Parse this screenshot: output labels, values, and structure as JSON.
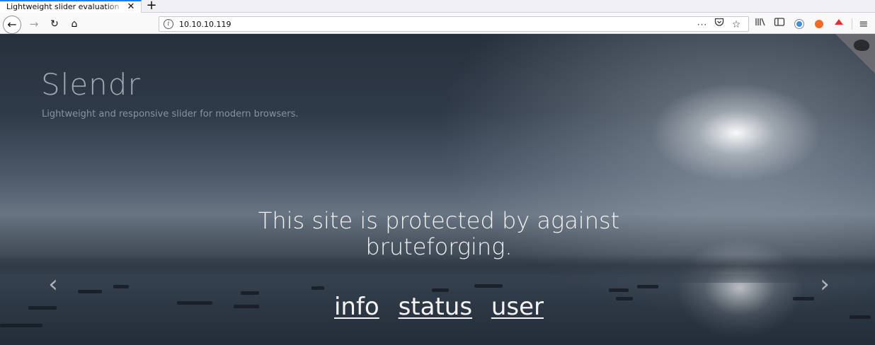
{
  "browser": {
    "tab_title": "Lightweight slider evaluation",
    "tab_close": "✕",
    "new_tab": "+",
    "url": "10.10.10.119",
    "icons": {
      "back": "back-arrow-icon",
      "forward": "forward-arrow-icon",
      "reload": "reload-icon",
      "home": "home-icon",
      "page_info": "info-icon",
      "page_actions": "more-icon",
      "pocket": "pocket-icon",
      "bookmark": "star-icon",
      "library": "library-icon",
      "sidebar": "sidebar-icon",
      "menu": "hamburger-menu-icon"
    }
  },
  "page": {
    "title": "Slendr",
    "subtitle": "Lightweight and responsive slider for modern browsers.",
    "caption": "This site is protected by against bruteforging.",
    "links": [
      "info",
      "status",
      "user"
    ],
    "prev_arrow": "‹",
    "next_arrow": "›"
  },
  "colors": {
    "accent": "#0a84ff",
    "caption_text": "#f1f1f1",
    "ext_blue": "#3d8fe0",
    "ext_orange": "#f06a2a",
    "ext_red": "#e0302f"
  }
}
